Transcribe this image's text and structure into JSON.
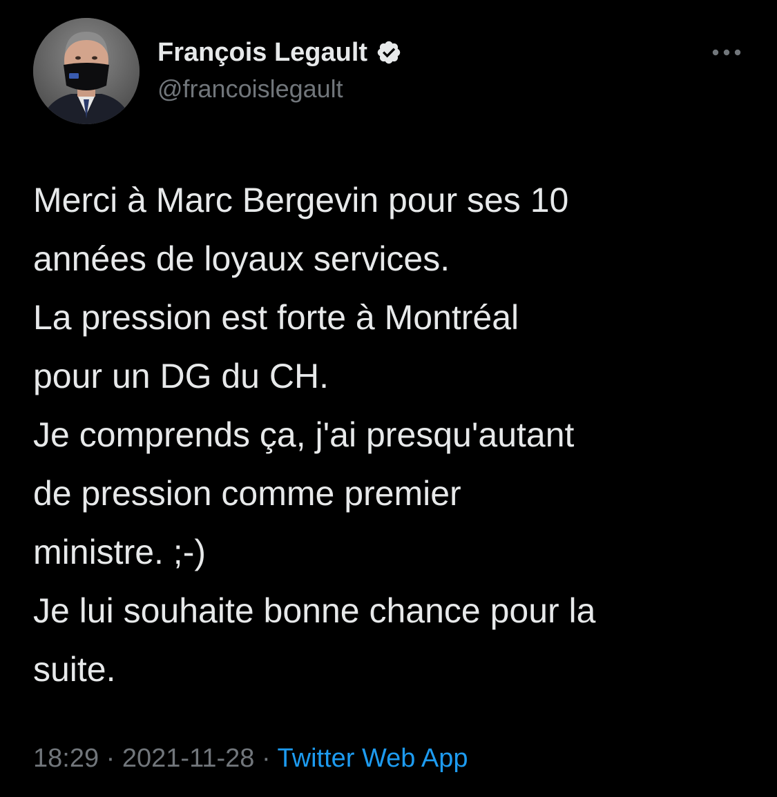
{
  "author": {
    "name": "François Legault",
    "handle": "@francoislegault",
    "verified": true,
    "avatar_icon": "profile-photo-masked-man"
  },
  "menu": {
    "icon": "more-horizontal-icon"
  },
  "tweet": {
    "lines": [
      "Merci à Marc Bergevin pour ses 10",
      "années de loyaux services.",
      "La pression est forte à Montréal",
      "pour un DG du CH.",
      "Je comprends ça, j'ai presqu'autant",
      "de pression comme premier",
      "ministre. ;-)",
      "Je lui souhaite bonne chance pour la",
      "suite."
    ]
  },
  "meta": {
    "time": "18:29",
    "separator": "·",
    "date": "2021-11-28",
    "source": "Twitter Web App"
  },
  "colors": {
    "background": "#000000",
    "text_primary": "#e7e9ea",
    "text_secondary": "#71767b",
    "accent": "#1d9bf0"
  }
}
